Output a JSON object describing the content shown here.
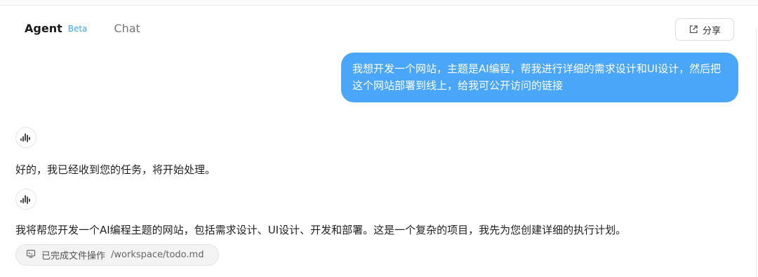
{
  "tabs": {
    "agent_label": "Agent",
    "agent_badge": "Beta",
    "chat_label": "Chat"
  },
  "header": {
    "share_label": "分享",
    "share_icon": "share-icon"
  },
  "conversation": {
    "user_message": "我想开发一个网站，主题是AI编程，帮我进行详细的需求设计和UI设计，然后把这个网站部署到线上，给我可公开访问的链接",
    "assistant_icon": "audio-wave-icon",
    "assistant_messages": [
      "好的，我已经收到您的任务，将开始处理。",
      "我将帮您开发一个AI编程主题的网站，包括需求设计、UI设计、开发和部署。这是一个复杂的项目，我先为您创建详细的执行计划。"
    ],
    "file_operation": {
      "icon": "terminal-icon",
      "status": "已完成文件操作",
      "path": "/workspace/todo.md"
    }
  },
  "colors": {
    "user_bubble": "#4aa6f8",
    "badge": "#3fa6f5"
  }
}
